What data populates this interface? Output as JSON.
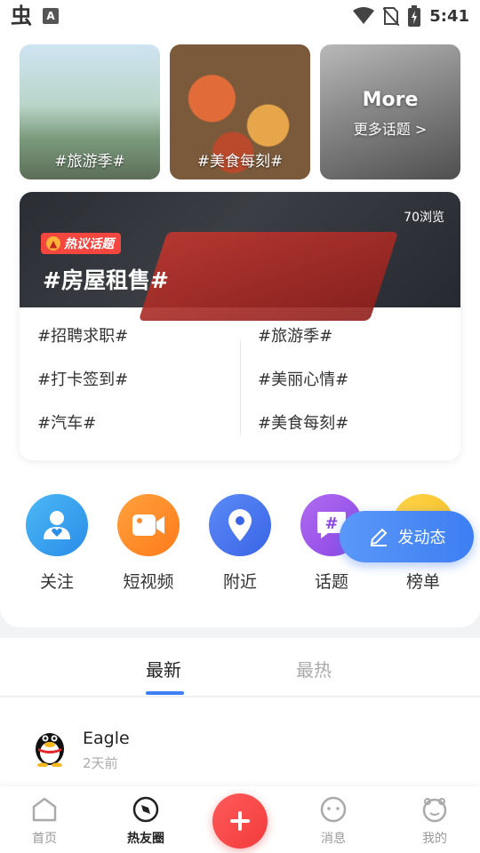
{
  "status_bar": {
    "time": "5:41",
    "left_icons": [
      "bug-icon",
      "a-icon"
    ],
    "right_icons": [
      "wifi-icon",
      "no-sim-icon",
      "battery-icon"
    ]
  },
  "topics": [
    {
      "label": "#旅游季#"
    },
    {
      "label": "#美食每刻#"
    },
    {
      "title": "More",
      "subtitle": "更多话题 >"
    }
  ],
  "hot_topic": {
    "badge": "热议话题",
    "title": "#房屋租售#",
    "views": "70浏览",
    "left_items": [
      "#招聘求职#",
      "#打卡签到#",
      "#汽车#"
    ],
    "right_items": [
      "#旅游季#",
      "#美丽心情#",
      "#美食每刻#"
    ]
  },
  "shortcuts": [
    {
      "label": "关注",
      "icon": "follow-icon",
      "color": "#2a8de8"
    },
    {
      "label": "短视频",
      "icon": "video-icon",
      "color": "#ff7a1a"
    },
    {
      "label": "附近",
      "icon": "location-icon",
      "color": "#3a64e6"
    },
    {
      "label": "话题",
      "icon": "hashtag-icon",
      "color": "#8a45e3"
    },
    {
      "label": "榜单",
      "icon": "rank-icon",
      "color": "#f5b81e"
    }
  ],
  "post_button": {
    "label": "发动态"
  },
  "tabs": {
    "latest": "最新",
    "hottest": "最热"
  },
  "post": {
    "name": "Eagle",
    "time": "2天前"
  },
  "bottom_nav": {
    "home": "首页",
    "circle": "热友圈",
    "messages": "消息",
    "mine": "我的"
  },
  "colors": {
    "accent": "#3d7ef3",
    "hot_red": "#f2463e",
    "plus_red": "#f23b3b"
  }
}
